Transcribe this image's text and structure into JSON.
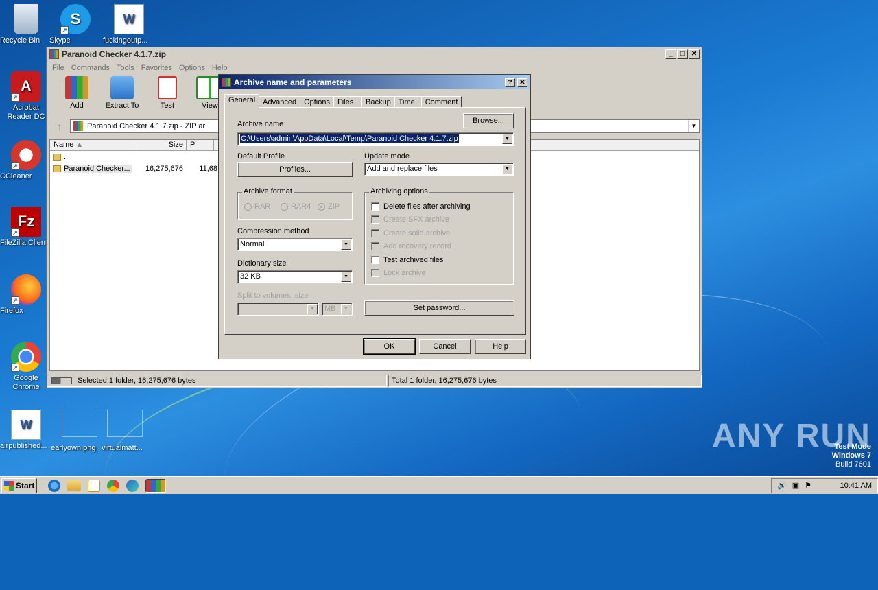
{
  "desktop": {
    "icons": [
      {
        "label": "Recycle Bin"
      },
      {
        "label": "Skype"
      },
      {
        "label": "fuckingoutp..."
      },
      {
        "label": "Acrobat Reader DC"
      },
      {
        "label": "CCleaner"
      },
      {
        "label": "FileZilla Client"
      },
      {
        "label": "Firefox"
      },
      {
        "label": "Google Chrome"
      },
      {
        "label": "airpublished..."
      },
      {
        "label": "earlyown.png"
      },
      {
        "label": "virtualmatt..."
      }
    ],
    "watermark": {
      "line1": "Test Mode",
      "line2": "Windows 7",
      "line3": "Build 7601"
    },
    "brand": "ANY RUN"
  },
  "winrar": {
    "title": "Paranoid Checker 4.1.7.zip",
    "menu": [
      "File",
      "Commands",
      "Tools",
      "Favorites",
      "Options",
      "Help"
    ],
    "toolbar": [
      {
        "label": "Add"
      },
      {
        "label": "Extract To"
      },
      {
        "label": "Test"
      },
      {
        "label": "View"
      }
    ],
    "address": "Paranoid Checker 4.1.7.zip - ZIP ar",
    "columns": {
      "name": "Name",
      "size": "Size",
      "packed": "P"
    },
    "rows": [
      {
        "name": "..",
        "size": "",
        "packed": ""
      },
      {
        "name": "Paranoid Checker...",
        "size": "16,275,676",
        "packed": "11,68"
      }
    ],
    "status_left": "Selected 1 folder, 16,275,676 bytes",
    "status_right": "Total 1 folder, 16,275,676 bytes"
  },
  "dialog": {
    "title": "Archive name and parameters",
    "help_btn": "?",
    "close_btn": "✕",
    "tabs": [
      "General",
      "Advanced",
      "Options",
      "Files",
      "Backup",
      "Time",
      "Comment"
    ],
    "archive_name_label": "Archive name",
    "browse_label": "Browse...",
    "archive_name_value": "C:\\Users\\admin\\AppData\\Local\\Temp\\Paranoid Checker 4.1.7.zip",
    "default_profile_label": "Default Profile",
    "profiles_label": "Profiles...",
    "update_mode_label": "Update mode",
    "update_mode_value": "Add and replace files",
    "archive_format_label": "Archive format",
    "formats": {
      "rar": "RAR",
      "rar4": "RAR4",
      "zip": "ZIP"
    },
    "selected_format": "ZIP",
    "archiving_options_label": "Archiving options",
    "options": {
      "delete": "Delete files after archiving",
      "sfx": "Create SFX archive",
      "solid": "Create solid archive",
      "recovery": "Add recovery record",
      "test": "Test archived files",
      "lock": "Lock archive"
    },
    "compression_method_label": "Compression method",
    "compression_method_value": "Normal",
    "dictionary_size_label": "Dictionary size",
    "dictionary_size_value": "32 KB",
    "split_label": "Split to volumes, size",
    "split_unit": "MB",
    "set_password_label": "Set password...",
    "ok_label": "OK",
    "cancel_label": "Cancel",
    "help_label": "Help"
  },
  "taskbar": {
    "start_label": "Start",
    "clock": "10:41 AM"
  },
  "colors": {
    "title_active": "#0a246a",
    "face": "#d4d0c8"
  }
}
